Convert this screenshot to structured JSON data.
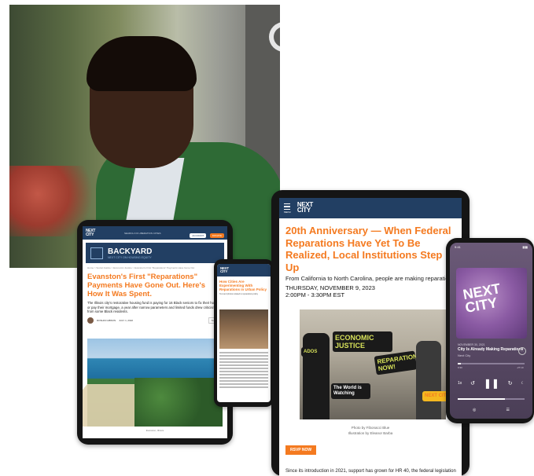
{
  "brand": {
    "logo_line1": "NEXT",
    "logo_line2": "CITY",
    "accent": "#f47a20",
    "navy": "#223f63"
  },
  "tablet_left": {
    "nav_text": "SEARCH  OF  LIBERATION  CITIES",
    "account": "ACCOUNT",
    "donate": "DONATE",
    "section_title": "BACKYARD",
    "section_subtitle": "NEXT CITY ON HOUSING EQUITY",
    "breadcrumb": "Home > Social Justice > Economic Justice > Evanston's First \"Reparations\" Payments Have Gone Out",
    "headline": "Evanston's First \"Reparations\" Payments Have Gone Out. Here's How It Was Spent.",
    "lede": "The Illinois city's restorative housing fund is paying for 16 Black seniors to fix their homes or pay their mortgage, a year after narrow parameters and limited funds drew criticism from some Black residents.",
    "author": "ROSHNI GIBSON",
    "date": "JULY 1, 2022",
    "share": "SHARE",
    "image_caption": "Evanston, Illinois"
  },
  "phone_middle": {
    "headline": "How Cities Are Experimenting With Reparations in Urban Policy",
    "meta": "Text and photos related to reparations policy"
  },
  "tablet_right": {
    "menu": "MENU",
    "headline": "20th Anniversary — When Federal Reparations Have Yet To Be Realized, Local Institutions Step Up",
    "subtitle": "From California to North Carolina, people are making reparations a reality.",
    "date": "THURSDAY, NOVEMBER 9, 2023",
    "time": "2:00PM - 3:30PM EST",
    "photo_credit": "Photo by Fibonacci Blue",
    "illustration_credit": "Illustration by Eleanor Barba",
    "signs": [
      "ECONOMIC JUSTICE",
      "REPARATIONS NOW!",
      "ADOS",
      "The World is Watching",
      "NEXT CIT"
    ],
    "rsvp": "RSVP NOW",
    "footer_text": "Since its introduction in 2021, support has grown for HR 40, the federal legislation"
  },
  "phone_right": {
    "time": "9:41",
    "episode_date": "NOVEMBER 30, 2021",
    "episode_title": "City Is Already Making Reparations",
    "show": "Next City",
    "art_line1": "NEXT",
    "art_line2": "CITY",
    "progress": 0.05,
    "elapsed": "0:30",
    "remaining": "-27:10",
    "speed": "1x",
    "volume": 0.7
  }
}
